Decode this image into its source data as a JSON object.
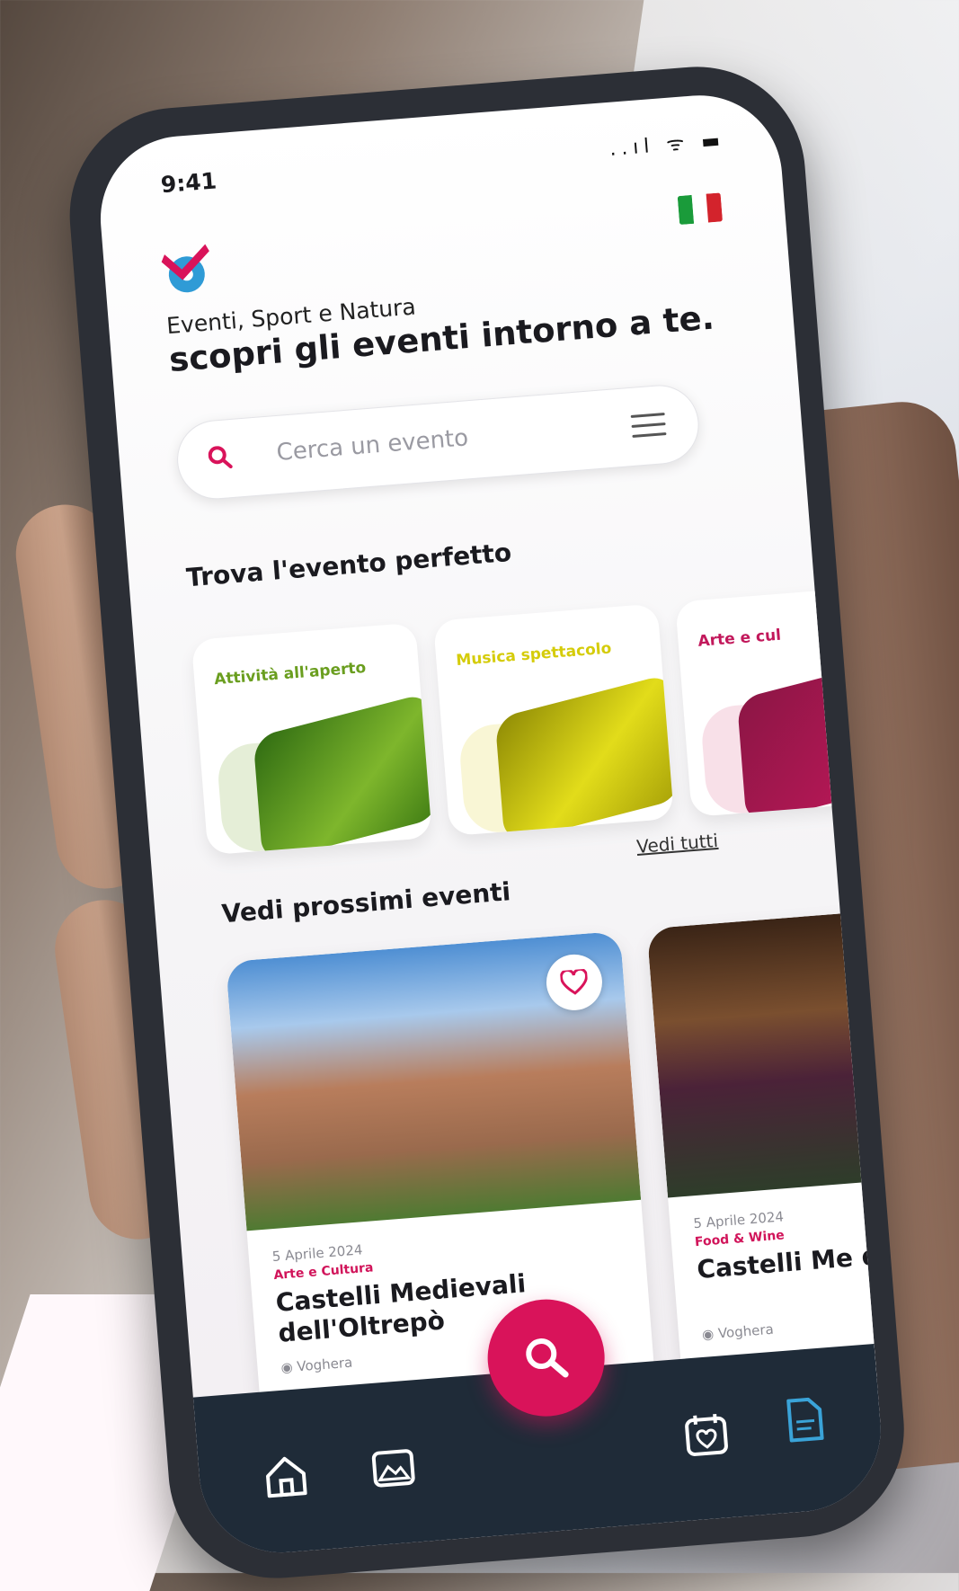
{
  "status_bar": {
    "time": "9:41",
    "icons": "..ıl ᯤ ▬"
  },
  "header": {
    "tagline": "Eventi, Sport e Natura",
    "headline": "scopri gli eventi intorno a te."
  },
  "search": {
    "placeholder": "Cerca un evento",
    "icon": "search-icon",
    "menu_icon": "hamburger-menu-icon"
  },
  "categories": {
    "title": "Trova l'evento perfetto",
    "items": [
      {
        "label": "Attività all'aperto",
        "color": "#6a9e1f"
      },
      {
        "label": "Musica spettacolo",
        "color": "#d5cc0a"
      },
      {
        "label": "Arte e cul",
        "color": "#c2185b"
      }
    ]
  },
  "events": {
    "title": "Vedi prossimi eventi",
    "see_all": "Vedi tutti",
    "items": [
      {
        "date": "5 Aprile 2024",
        "category": "Arte e Cultura",
        "title": "Castelli Medievali dell'Oltrepò",
        "location": "Voghera"
      },
      {
        "date": "5 Aprile 2024",
        "category": "Food & Wine",
        "title": "Castelli Me dell'OltreP",
        "location": "Voghera"
      }
    ]
  },
  "nav": {
    "items": [
      "home-icon",
      "map-icon",
      "search-icon",
      "calendar-heart-icon",
      "document-icon"
    ]
  },
  "colors": {
    "accent": "#d9135a",
    "navbar": "#1f2b38",
    "active_nav": "#3aa3d8"
  }
}
